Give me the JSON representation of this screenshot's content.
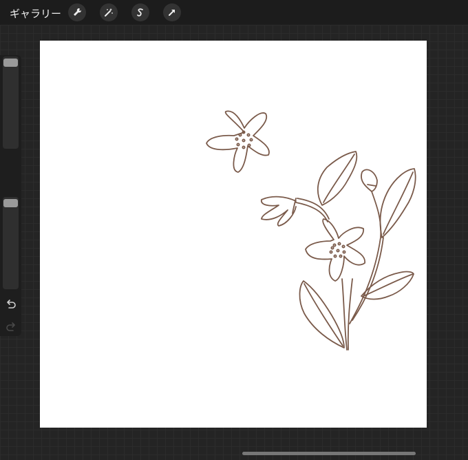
{
  "toolbar": {
    "gallery_label": "ギャラリー",
    "tools": [
      "wrench-icon",
      "magic-wand-icon",
      "selection-icon",
      "transform-arrow-icon"
    ]
  },
  "sidebar": {
    "brush_size_level": 1.0,
    "opacity_level": 1.0,
    "modify_button": "square-icon",
    "undo": "undo-icon",
    "redo": "redo-icon"
  },
  "canvas": {
    "background": "#ffffff",
    "line_color": "#7a5a4a",
    "drawing": "flower-line-art"
  },
  "colors": {
    "app_background": "#242424",
    "toolbar_background": "#1c1c1c"
  }
}
